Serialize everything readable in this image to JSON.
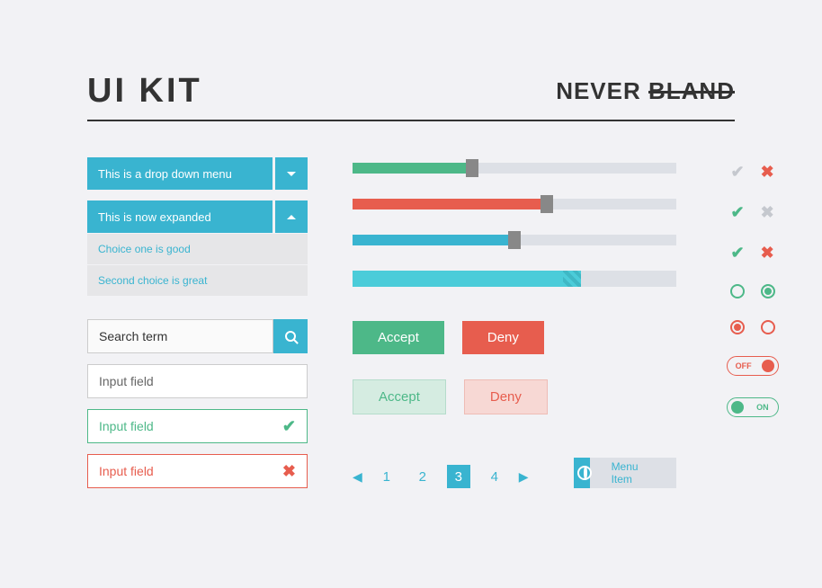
{
  "header": {
    "title": "UI KIT",
    "brand_prefix": "NEVER ",
    "brand_strike": "BLAND"
  },
  "dropdowns": {
    "collapsed": {
      "label": "This is a drop down menu"
    },
    "expanded": {
      "label": "This is now expanded",
      "choices": [
        "Choice one is good",
        "Second choice is great"
      ]
    }
  },
  "search": {
    "value": "Search term"
  },
  "inputs": {
    "plain": "Input field",
    "valid": "Input field",
    "invalid": "Input field"
  },
  "sliders": {
    "green": {
      "percent": 37
    },
    "red": {
      "percent": 60
    },
    "blue": {
      "percent": 50
    }
  },
  "progress": {
    "percent": 65
  },
  "buttons": {
    "accept": "Accept",
    "deny": "Deny"
  },
  "pagination": {
    "pages": [
      "1",
      "2",
      "3",
      "4"
    ],
    "active": "3"
  },
  "menu": {
    "label": "Menu Item"
  },
  "toggles": {
    "off": "OFF",
    "on": "ON"
  }
}
